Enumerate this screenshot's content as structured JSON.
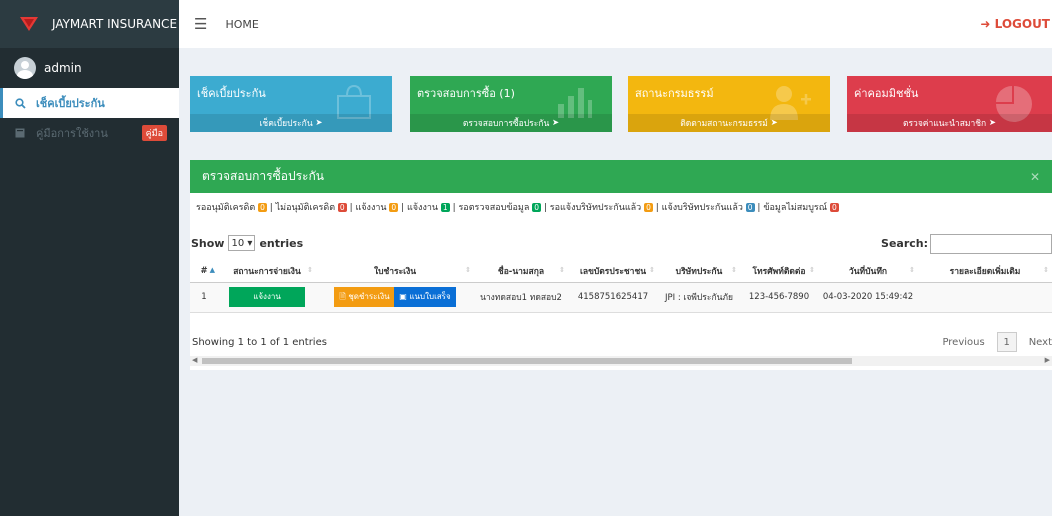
{
  "sidebar": {
    "brand": "JAYMART INSURANCE",
    "user": "admin",
    "items": [
      {
        "label": "เช็คเบี้ยประกัน"
      },
      {
        "label": "คู่มือการใช้งาน",
        "badge": "คู่มือ"
      }
    ]
  },
  "header": {
    "home": "HOME",
    "logout": "LOGOUT"
  },
  "tiles": [
    {
      "title": "เช็คเบี้ยประกัน",
      "footer": "เช็คเบี้ยประกัน",
      "color": "#3cabd0",
      "icon": "shopping-bag-icon"
    },
    {
      "title": "ตรวจสอบการซื้อ (1)",
      "footer": "ตรวจสอบการซื้อประกัน",
      "color": "#2fa853",
      "icon": "bar-chart-icon"
    },
    {
      "title": "สถานะกรมธรรม์",
      "footer": "ติดตามสถานะกรมธรรม์",
      "color": "#f3b70f",
      "icon": "user-add-icon"
    },
    {
      "title": "ค่าคอมมิชชั่น",
      "footer": "ตรวจค่าแนะนำสมาชิก",
      "color": "#dd3d4c",
      "icon": "pie-chart-icon"
    }
  ],
  "panel": {
    "title": "ตรวจสอบการซื้อประกัน",
    "legend": [
      {
        "label": "รออนุมัติเครดิต",
        "count": "0",
        "color": "#f39c12"
      },
      {
        "label": "ไม่อนุมัติเครดิต",
        "count": "0",
        "color": "#dd4b39"
      },
      {
        "label": "แจ้งงาน",
        "count": "0",
        "color": "#f39c12"
      },
      {
        "label": "แจ้งงาน",
        "count": "1",
        "color": "#00a65a"
      },
      {
        "label": "รอตรวจสอบข้อมูล",
        "count": "0",
        "color": "#00a65a"
      },
      {
        "label": "รอแจ้งบริษัทประกันแล้ว",
        "count": "0",
        "color": "#f39c12"
      },
      {
        "label": "แจ้งบริษัทประกันแล้ว",
        "count": "0",
        "color": "#3c8dbc"
      },
      {
        "label": "ข้อมูลไม่สมบูรณ์",
        "count": "0",
        "color": "#dd4b39"
      }
    ],
    "show_label": "Show",
    "entries_value": "10",
    "entries_label": "entries",
    "search_label": "Search:",
    "columns": [
      "#",
      "สถานะการจ่ายเงิน",
      "ใบชำระเงิน",
      "ชื่อ-นามสกุล",
      "เลขบัตรประชาชน",
      "บริษัทประกัน",
      "โทรศัพท์ติดต่อ",
      "วันที่บันทึก",
      "รายละเอียดเพิ่มเติม"
    ],
    "rows": [
      {
        "no": "1",
        "status": "แจ้งงาน",
        "pay_btn": "ชุดชำระเงิน",
        "file_btn": "แนบใบเสร็จ",
        "name": "นางทดสอบ1 ทดสอบ2",
        "id_card": "4158751625417",
        "company": "JPI : เจพีประกันภัย",
        "phone": "123-456-7890",
        "date": "04-03-2020 15:49:42",
        "detail": ""
      }
    ],
    "info": "Showing 1 to 1 of 1 entries",
    "prev": "Previous",
    "page": "1",
    "next": "Next"
  }
}
